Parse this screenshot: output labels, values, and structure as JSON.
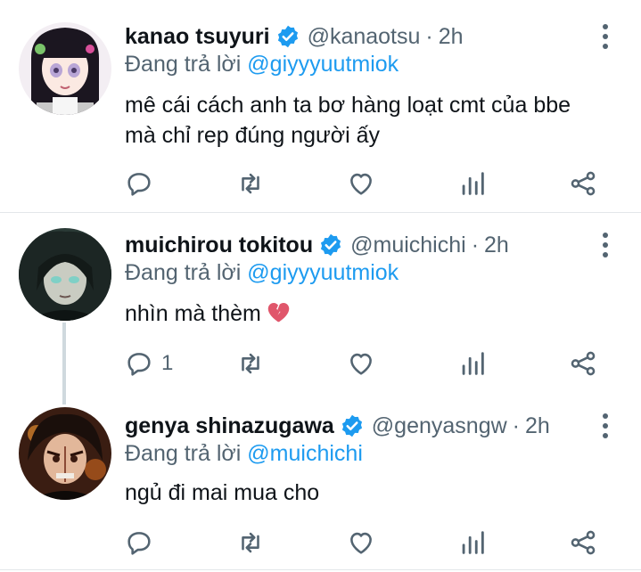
{
  "colors": {
    "text": "#0f1419",
    "secondary": "#536471",
    "link": "#1d9bf0",
    "verified": "#1d9bf0",
    "divider": "#e3e7ea"
  },
  "replying_prefix": "Đang trả lời",
  "tweets": [
    {
      "name": "kanao tsuyuri",
      "handle": "@kanaotsu",
      "separator": "·",
      "time": "2h",
      "verified": true,
      "reply_to": "@giyyyuutmiok",
      "text": "mê cái cách anh ta bơ hàng loạt cmt của bbe mà chỉ rep đúng người ấy",
      "reply_count": "",
      "avatar_icon": "kanao-avatar"
    },
    {
      "name": "muichirou tokitou",
      "handle": "@muichichi",
      "separator": "·",
      "time": "2h",
      "verified": true,
      "reply_to": "@giyyyuutmiok",
      "text": "nhìn mà thèm",
      "emoji": "broken-heart-icon",
      "reply_count": "1",
      "avatar_icon": "muichirou-avatar"
    },
    {
      "name": "genya shinazugawa",
      "handle": "@genyasngw",
      "separator": "·",
      "time": "2h",
      "verified": true,
      "reply_to": "@muichichi",
      "text": "ngủ đi mai mua cho",
      "reply_count": "",
      "avatar_icon": "genya-avatar"
    }
  ],
  "action_icons": [
    "reply-icon",
    "retweet-icon",
    "like-icon",
    "analytics-icon",
    "share-icon"
  ]
}
